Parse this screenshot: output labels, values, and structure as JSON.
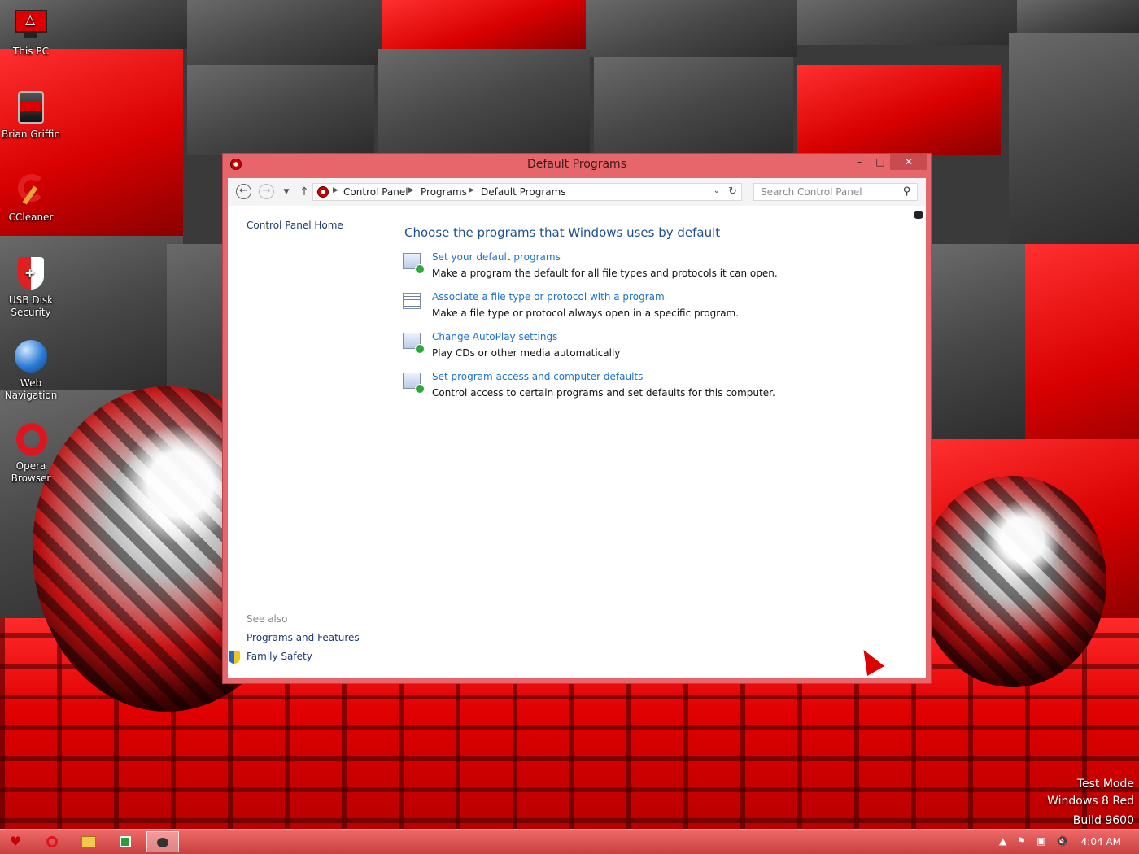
{
  "desktop": {
    "icons": [
      {
        "label": "This PC",
        "icon": "monitor-icon"
      },
      {
        "label": "Brian Griffin",
        "icon": "user-folder-icon"
      },
      {
        "label": "CCleaner",
        "icon": "ccleaner-icon"
      },
      {
        "label": "USB Disk Security",
        "label_line1": "USB Disk",
        "label_line2": "Security",
        "icon": "shield-icon"
      },
      {
        "label": "Web Navigation",
        "label_line1": "Web",
        "label_line2": "Navigation",
        "icon": "globe-icon"
      },
      {
        "label": "Opera Browser",
        "label_line1": "Opera",
        "label_line2": "Browser",
        "icon": "opera-icon"
      }
    ],
    "watermark": [
      "Test Mode",
      "Windows 8 Red",
      "Build 9600"
    ]
  },
  "window": {
    "title": "Default Programs",
    "controls": {
      "minimize": "–",
      "maximize": "□",
      "close": "✕"
    },
    "breadcrumb": [
      "Control Panel",
      "Programs",
      "Default Programs"
    ],
    "search_placeholder": "Search Control Panel",
    "sidebar": {
      "home": "Control Panel Home",
      "see_also_label": "See also",
      "see_also": [
        "Programs and Features",
        "Family Safety"
      ]
    },
    "main": {
      "heading": "Choose the programs that Windows uses by default",
      "tasks": [
        {
          "link": "Set your default programs",
          "desc": "Make a program the default for all file types and protocols it can open.",
          "icon": "default-programs-icon"
        },
        {
          "link": "Associate a file type or protocol with a program",
          "desc": "Make a file type or protocol always open in a specific program.",
          "icon": "file-association-icon"
        },
        {
          "link": "Change AutoPlay settings",
          "desc": "Play CDs or other media automatically",
          "icon": "autoplay-icon"
        },
        {
          "link": "Set program access and computer defaults",
          "desc": "Control access to certain programs and set defaults for this computer.",
          "icon": "program-access-icon"
        }
      ]
    }
  },
  "taskbar": {
    "items": [
      "start-icon",
      "opera-icon",
      "file-explorer-icon",
      "store-icon",
      "control-panel-icon"
    ],
    "clock": "4:04 AM"
  },
  "colors": {
    "accent": "#e7666c",
    "link": "#1a6fcf",
    "heading": "#1d4f91"
  }
}
